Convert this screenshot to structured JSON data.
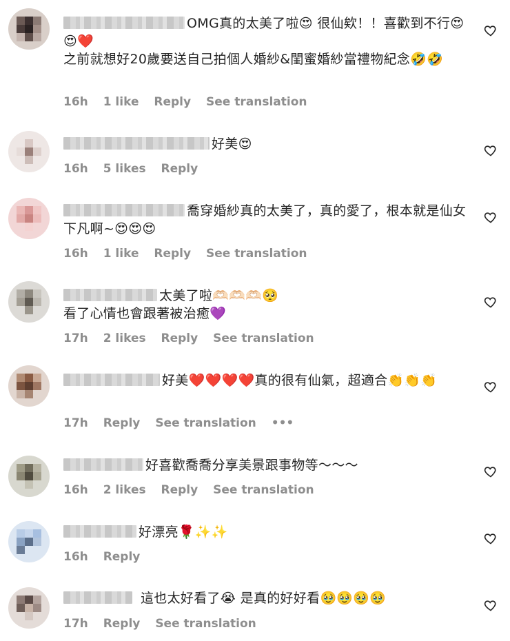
{
  "comments": [
    {
      "text": "OMG真的太美了啦😍 很仙欸！！喜歡到不行😍😍❤️\n之前就想好20歲要送自己拍個人婚紗&閨蜜婚紗當禮物紀念🤣🤣",
      "time": "16h",
      "likes": "1 like",
      "reply": "Reply",
      "translate": "See translation"
    },
    {
      "text": "好美😍",
      "time": "16h",
      "likes": "5 likes",
      "reply": "Reply"
    },
    {
      "text": "喬穿婚紗真的太美了，真的愛了，根本就是仙女下凡啊~😍😍😍",
      "time": "16h",
      "likes": "1 like",
      "reply": "Reply",
      "translate": "See translation"
    },
    {
      "text": "太美了啦🫶🏻🫶🏻🫶🏻🥺\n看了心情也會跟著被治癒💜",
      "time": "17h",
      "likes": "2 likes",
      "reply": "Reply",
      "translate": "See translation"
    },
    {
      "text": "好美❤️❤️❤️❤️真的很有仙氣，超適合👏👏👏",
      "time": "17h",
      "reply": "Reply",
      "translate": "See translation",
      "more": "•••"
    },
    {
      "text": "好喜歡喬喬分享美景跟事物等～～～",
      "time": "16h",
      "likes": "2 likes",
      "reply": "Reply",
      "translate": "See translation"
    },
    {
      "text": "好漂亮🌹✨✨",
      "time": "16h",
      "reply": "Reply"
    },
    {
      "text": "這也太好看了😭 是真的好好看🥹🥹🥹🥹",
      "time": "17h",
      "reply": "Reply",
      "translate": "See translation"
    }
  ],
  "icons": {
    "like": "heart-outline-icon",
    "avatar": "blurred-avatar"
  },
  "colors": {
    "text": "#262626",
    "meta": "#8e8e8e",
    "background": "#ffffff"
  }
}
